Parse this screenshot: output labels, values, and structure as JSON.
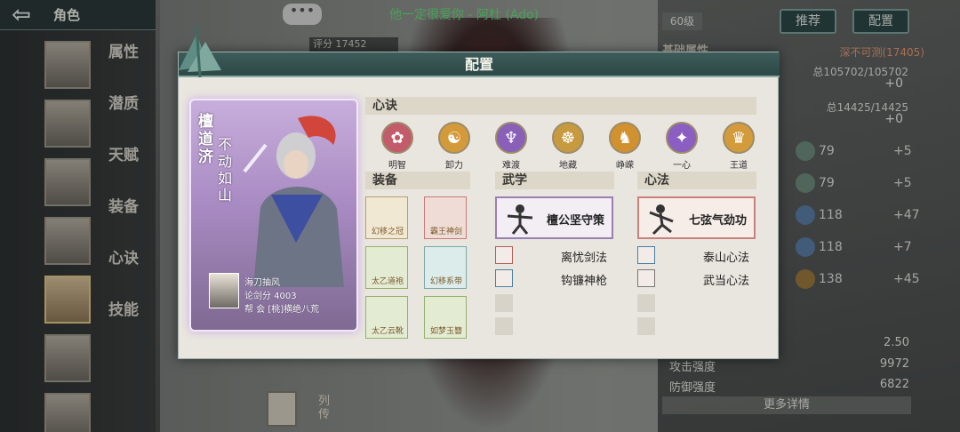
{
  "top": {
    "back_label": "⇦",
    "title": "角色",
    "chat_icon": "•••",
    "marquee": "他一定很爱你 - 阿杜 (Ado)",
    "score": "评分 17452"
  },
  "nav": {
    "items": [
      "属性",
      "潜质",
      "天赋",
      "装备",
      "心诀",
      "技能"
    ]
  },
  "right": {
    "level": "60级",
    "recommend": "推荐",
    "config": "配置",
    "basic_attr": "基础属性",
    "deep": "深不可测(17405)",
    "hp_total": "总105702/105702",
    "hp_plus": "+0",
    "mp_total": "总14425/14425",
    "mp_plus": "+0",
    "skills": [
      {
        "icon": "sword-icon",
        "value": "79",
        "plus": "+5"
      },
      {
        "icon": "sword-icon",
        "value": "79",
        "plus": "+5"
      },
      {
        "icon": "blade-icon",
        "value": "118",
        "plus": "+47"
      },
      {
        "icon": "blade-icon",
        "value": "118",
        "plus": "+7"
      },
      {
        "icon": "fist-icon",
        "value": "138",
        "plus": "+45"
      }
    ],
    "stats": [
      {
        "label": "",
        "value": "2.50"
      },
      {
        "label": "攻击强度",
        "value": "9972"
      },
      {
        "label": "防御强度",
        "value": "6822"
      }
    ],
    "more": "更多详情",
    "bottom_text": "列传"
  },
  "dialog": {
    "title": "配置",
    "card": {
      "name": "檀道济",
      "title": "不动如山",
      "player": "海刀抽风",
      "power": "论剑分 4003",
      "guild": "帮  会 [桃]横绝八荒"
    },
    "xinjue_label": "心诀",
    "xinjue": [
      {
        "label": "明智",
        "color": "#c25b6a",
        "glyph": "✿"
      },
      {
        "label": "卸力",
        "color": "#d49a3a",
        "glyph": "☯"
      },
      {
        "label": "难渡",
        "color": "#8a5fb8",
        "glyph": "♆"
      },
      {
        "label": "地藏",
        "color": "#c79a3f",
        "glyph": "☸"
      },
      {
        "label": "峥嵘",
        "color": "#d1912f",
        "glyph": "♞"
      },
      {
        "label": "一心",
        "color": "#8b5fc2",
        "glyph": "✦"
      },
      {
        "label": "王道",
        "color": "#d39b3b",
        "glyph": "♛"
      }
    ],
    "equip_label": "装备",
    "equip": [
      {
        "name": "幻移之冠",
        "style": "gold"
      },
      {
        "name": "霸王神剑",
        "style": "red"
      },
      {
        "name": "太乙道袍",
        "style": "grn"
      },
      {
        "name": "幻移系带",
        "style": "teal"
      },
      {
        "name": "太乙云靴",
        "style": "grn"
      },
      {
        "name": "如梦玉簪",
        "style": "grn"
      }
    ],
    "wuxue_label": "武学",
    "wuxue_main": "檀公坚守策",
    "wuxue": [
      "离忧剑法",
      "钩镰神枪"
    ],
    "xinfa_label": "心法",
    "xinfa_main": "七弦气劲功",
    "xinfa": [
      "泰山心法",
      "武当心法"
    ]
  }
}
